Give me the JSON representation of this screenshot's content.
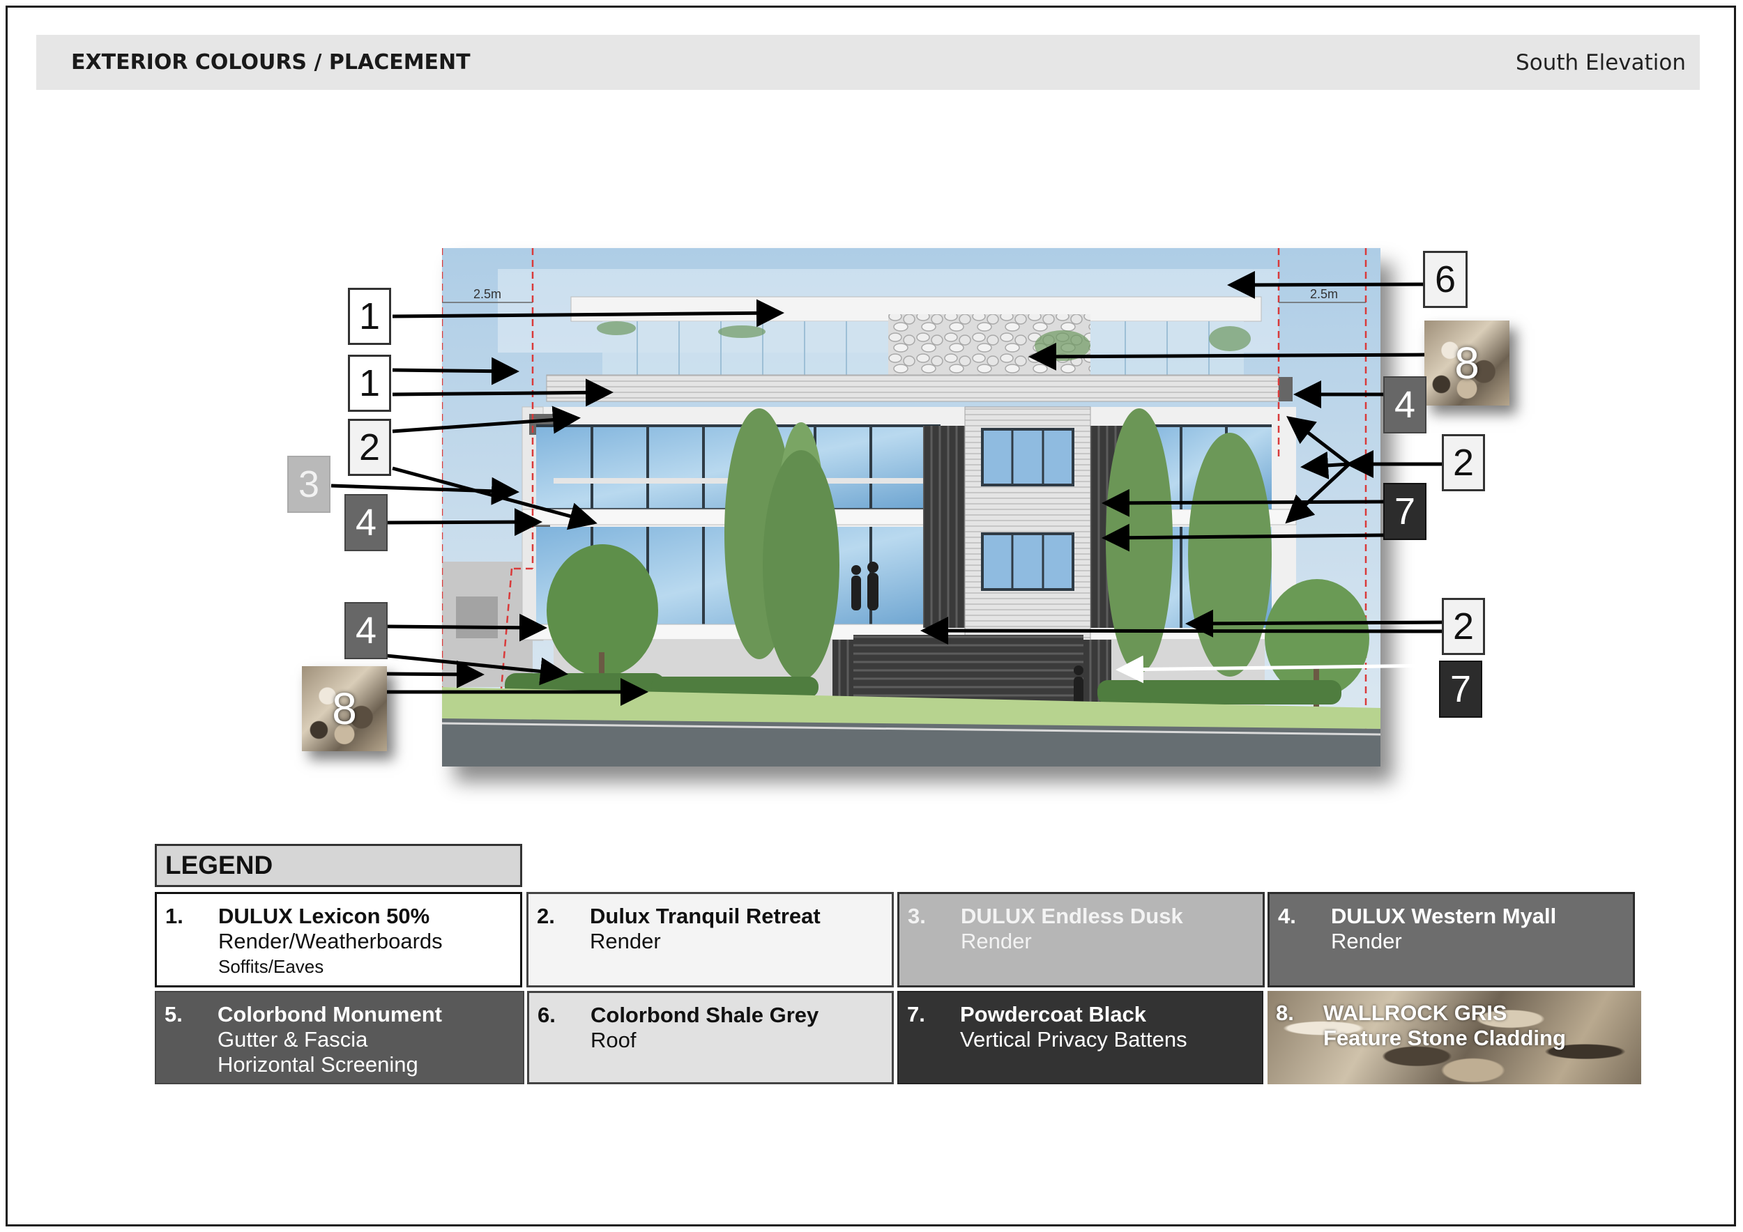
{
  "header": {
    "title": "EXTERIOR COLOURS / PLACEMENT",
    "view": "South Elevation"
  },
  "elevation": {
    "dimension_left": "2.5m",
    "dimension_right": "2.5m"
  },
  "callouts": {
    "c1a": "1",
    "c1b": "1",
    "c2a": "2",
    "c3": "3",
    "c4a": "4",
    "c4b": "4",
    "c8a": "8",
    "c6": "6",
    "c8b": "8",
    "c4c": "4",
    "c2b": "2",
    "c7a": "7",
    "c2c": "2",
    "c7b": "7"
  },
  "legend": {
    "title": "LEGEND",
    "items": [
      {
        "num": "1.",
        "name": "DULUX Lexicon 50%",
        "line2": "Render/Weatherboards",
        "line3": "Soffits/Eaves",
        "swatch": "#ffffff"
      },
      {
        "num": "2.",
        "name": "Dulux Tranquil Retreat",
        "line2": "Render",
        "swatch": "#f4f4f4"
      },
      {
        "num": "3.",
        "name": "DULUX Endless Dusk",
        "line2": "Render",
        "swatch": "#b6b6b6"
      },
      {
        "num": "4.",
        "name": "DULUX Western Myall",
        "line2": "Render",
        "swatch": "#6d6d6d"
      },
      {
        "num": "5.",
        "name": "Colorbond Monument",
        "line2": "Gutter & Fascia",
        "line3": "Horizontal Screening",
        "swatch": "#595959"
      },
      {
        "num": "6.",
        "name": "Colorbond Shale Grey",
        "line2": "Roof",
        "swatch": "#e1e1e1"
      },
      {
        "num": "7.",
        "name": "Powdercoat Black",
        "line2": "Vertical Privacy Battens",
        "swatch": "#333333"
      },
      {
        "num": "8.",
        "name": "WALLROCK GRIS",
        "line2": "Feature Stone Cladding",
        "swatch": "stone-texture"
      }
    ]
  }
}
